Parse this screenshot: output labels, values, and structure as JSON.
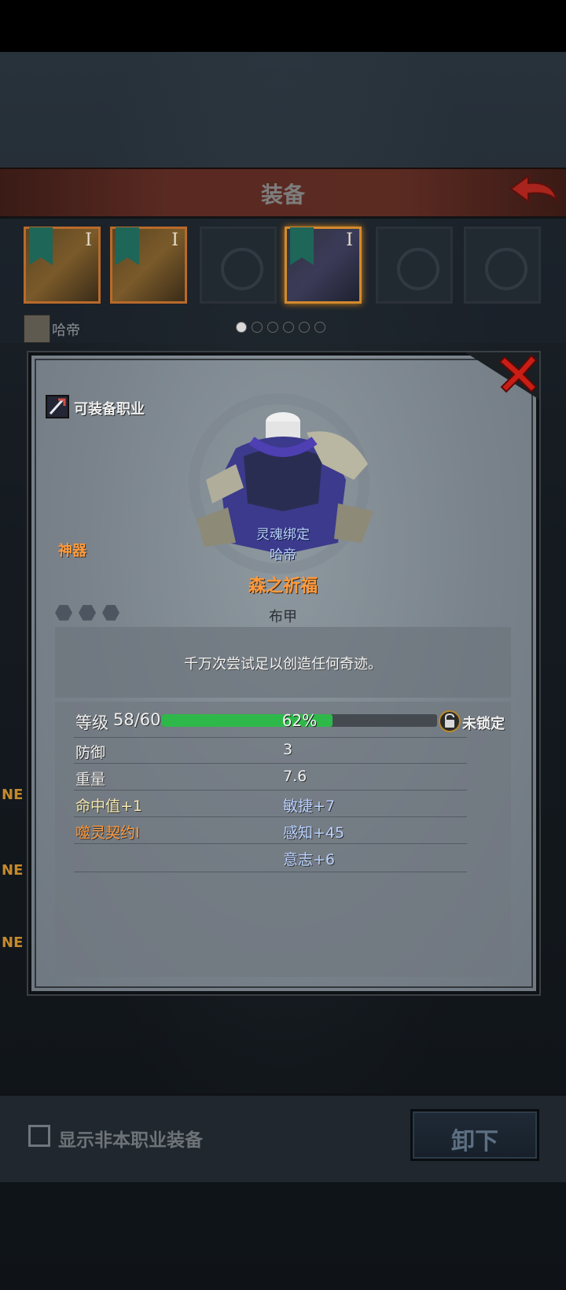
{
  "header": {
    "title": "装备"
  },
  "equipment_slots": {
    "roman_marks": [
      "I",
      "I",
      "I"
    ],
    "hero_name": "哈帝"
  },
  "side_tags": [
    "NE",
    "NE",
    "NE"
  ],
  "popup": {
    "class_label": "可装备职业",
    "rarity": "神器",
    "soul_bind": "灵魂绑定",
    "soul_owner": "哈帝",
    "item_name": "森之祈福",
    "item_type": "布甲",
    "description": "千万次尝试足以创造任何奇迹。",
    "level_label": "等级",
    "level_value": "58/60",
    "xp_percent": 62,
    "xp_text": "62%",
    "lock_label": "未锁定",
    "stats": {
      "defense_label": "防御",
      "defense_value": "3",
      "weight_label": "重量",
      "weight_value": "7.6",
      "hit_label": "命中值+1",
      "agility_label": "敏捷+7",
      "curse_label": "噬灵契约I",
      "perception_label": "感知+45",
      "will_label": "意志+6"
    }
  },
  "bottom": {
    "show_other_label": "显示非本职业装备",
    "unequip_label": "卸下"
  },
  "colors": {
    "rarity_orange": "#ff9a3c",
    "xp_green": "#2fb84a",
    "stat_blue": "#b9d1ff",
    "close_red": "#c81e16"
  },
  "icons": [
    "back-arrow-icon",
    "close-icon",
    "class-icon",
    "lock-icon",
    "armor-icon",
    "checkbox-icon"
  ]
}
